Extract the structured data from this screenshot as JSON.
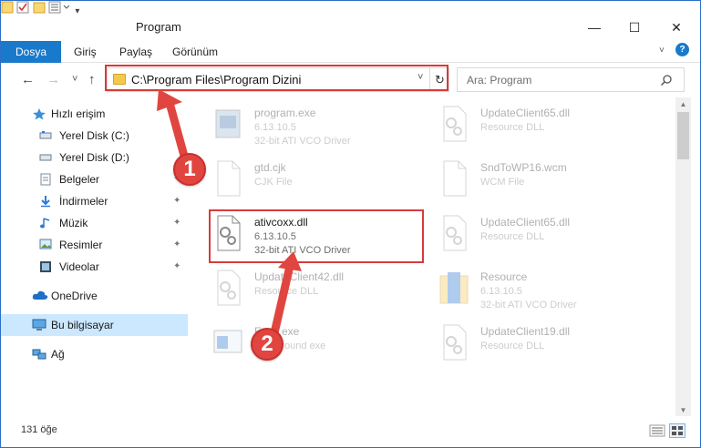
{
  "window": {
    "title": "Program",
    "minimize": "—",
    "maximize": "☐",
    "close": "✕"
  },
  "ribbon": {
    "file_tab": "Dosya",
    "tabs": [
      "Giriş",
      "Paylaş",
      "Görünüm"
    ],
    "help": "?"
  },
  "nav": {
    "back": "←",
    "forward": "→",
    "recent": "˅",
    "up": "↑",
    "address": "C:\\Program Files\\Program Dizini",
    "address_chevron": "˅",
    "refresh": "↻",
    "search_placeholder": "Ara: Program"
  },
  "sidebar": {
    "items": [
      {
        "label": "Hızlı erişim",
        "icon": "star-icon"
      },
      {
        "label": "Yerel Disk (C:)",
        "icon": "drive-icon"
      },
      {
        "label": "Yerel Disk (D:)",
        "icon": "drive-icon"
      },
      {
        "label": "Belgeler",
        "icon": "documents-icon"
      },
      {
        "label": "İndirmeler",
        "icon": "download-icon"
      },
      {
        "label": "Müzik",
        "icon": "music-icon"
      },
      {
        "label": "Resimler",
        "icon": "pictures-icon"
      },
      {
        "label": "Videolar",
        "icon": "video-icon"
      },
      {
        "label": "OneDrive",
        "icon": "cloud-icon"
      },
      {
        "label": "Bu bilgisayar",
        "icon": "computer-icon"
      },
      {
        "label": "Ağ",
        "icon": "network-icon"
      }
    ],
    "pin": "📌"
  },
  "files": {
    "left": [
      {
        "name": "program.exe",
        "version": "6.13.10.5",
        "desc": "32-bit ATI VCO Driver",
        "icon": "exe-icon"
      },
      {
        "name": "gtd.cjk",
        "version": "CJK File",
        "desc": "",
        "icon": "blank-file-icon"
      },
      {
        "name": "ativcoxx.dll",
        "version": "6.13.10.5",
        "desc": "32-bit ATI VCO Driver",
        "icon": "dll-icon"
      },
      {
        "name": "UpdateClient42.dll",
        "version": "Resource DLL",
        "desc": "",
        "icon": "dll-icon"
      },
      {
        "name": "Exec.exe",
        "version": "background exe",
        "desc": "",
        "icon": "exe-icon"
      }
    ],
    "right": [
      {
        "name": "UpdateClient65.dll",
        "version": "Resource DLL",
        "desc": "",
        "icon": "dll-icon"
      },
      {
        "name": "SndToWP16.wcm",
        "version": "WCM File",
        "desc": "",
        "icon": "blank-file-icon"
      },
      {
        "name": "UpdateClient65.dll",
        "version": "Resource DLL",
        "desc": "",
        "icon": "dll-icon"
      },
      {
        "name": "Resource",
        "version": "6.13.10.5",
        "desc": "32-bit ATI VCO Driver",
        "icon": "folder-icon"
      },
      {
        "name": "UpdateClient19.dll",
        "version": "Resource DLL",
        "desc": "",
        "icon": "dll-icon"
      }
    ]
  },
  "status": {
    "count": "131 öğe"
  },
  "callouts": {
    "one": "1",
    "two": "2"
  },
  "colors": {
    "accent": "#1979ca",
    "highlight": "#d73b3b",
    "selected": "#cce8ff"
  }
}
